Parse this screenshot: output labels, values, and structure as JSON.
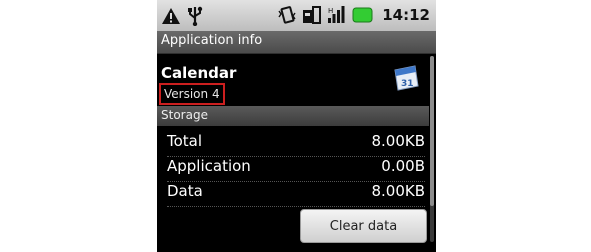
{
  "statusbar": {
    "left_icons": [
      "warning-icon",
      "usb-icon"
    ],
    "right_icons": [
      "vibrate-icon",
      "sim-icon",
      "signal-icon",
      "battery-icon"
    ],
    "time": "14:12",
    "battery_color": "#33cc33"
  },
  "titlebar": {
    "title": "Application info"
  },
  "app": {
    "name": "Calendar",
    "version": "Version 4",
    "icon": "calendar-icon",
    "icon_date": "31"
  },
  "storage": {
    "header": "Storage",
    "rows": [
      {
        "label": "Total",
        "value": "8.00KB"
      },
      {
        "label": "Application",
        "value": "0.00B"
      },
      {
        "label": "Data",
        "value": "8.00KB"
      }
    ],
    "clear_button": "Clear data"
  },
  "colors": {
    "highlight_border": "#cc1f1f",
    "background": "#000000",
    "text": "#ffffff"
  }
}
